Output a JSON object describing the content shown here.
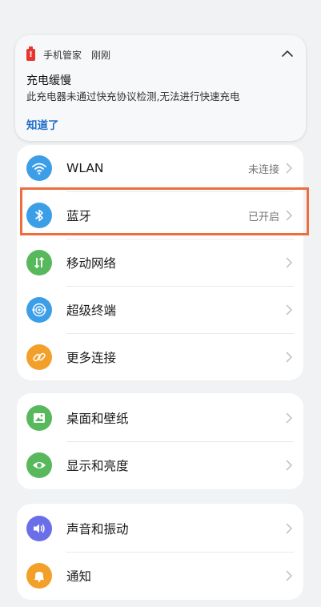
{
  "notification": {
    "app_name": "手机管家",
    "time": "刚刚",
    "title": "充电缓慢",
    "message": "此充电器未通过快充协议检测,无法进行快速充电",
    "action": "知道了"
  },
  "groups": [
    {
      "items": [
        {
          "label": "WLAN",
          "status": "未连接",
          "icon": "wifi-icon",
          "color": "#3d9ee8"
        },
        {
          "label": "蓝牙",
          "status": "已开启",
          "icon": "bluetooth-icon",
          "color": "#3d9ee8",
          "highlighted": true
        },
        {
          "label": "移动网络",
          "status": "",
          "icon": "mobile-network-icon",
          "color": "#58b85c"
        },
        {
          "label": "超级终端",
          "status": "",
          "icon": "super-device-icon",
          "color": "#3d9ee8"
        },
        {
          "label": "更多连接",
          "status": "",
          "icon": "link-icon",
          "color": "#f3a02b"
        }
      ]
    },
    {
      "items": [
        {
          "label": "桌面和壁纸",
          "status": "",
          "icon": "wallpaper-icon",
          "color": "#58b85c"
        },
        {
          "label": "显示和亮度",
          "status": "",
          "icon": "eye-icon",
          "color": "#58b85c"
        }
      ]
    },
    {
      "items": [
        {
          "label": "声音和振动",
          "status": "",
          "icon": "speaker-icon",
          "color": "#6a6ee8"
        },
        {
          "label": "通知",
          "status": "",
          "icon": "bell-icon",
          "color": "#f3a02b"
        }
      ]
    }
  ]
}
